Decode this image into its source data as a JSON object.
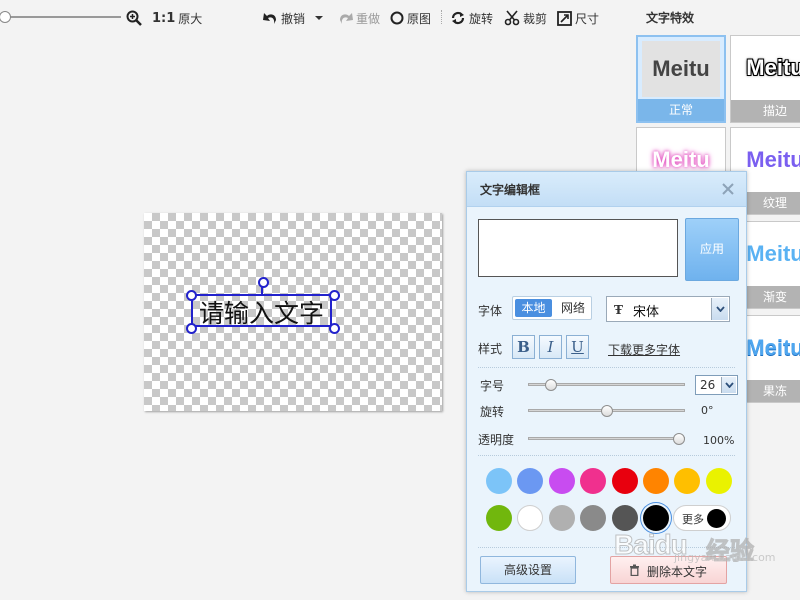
{
  "toolbar": {
    "actual_size_ratio": "1:1",
    "actual_size_label": "原大",
    "undo_label": "撤销",
    "redo_label": "重做",
    "original_label": "原图",
    "rotate_label": "旋转",
    "crop_label": "裁剪",
    "resize_label": "尺寸",
    "zoom_level": 0.0
  },
  "canvas": {
    "text": "请输入文字"
  },
  "effects": {
    "title": "文字特效",
    "items": [
      {
        "preview": "Meitu",
        "label": "正常",
        "selected": true
      },
      {
        "preview": "Meitu",
        "label": "描边",
        "selected": false
      },
      {
        "preview": "Meitu",
        "label": "",
        "selected": false
      },
      {
        "preview": "Meitu",
        "label": "纹理",
        "selected": false
      },
      {
        "preview": "Meitu",
        "label": "渐变",
        "selected": false
      },
      {
        "preview": "Meitu",
        "label": "果冻",
        "selected": false
      }
    ]
  },
  "dialog": {
    "title": "文字编辑框",
    "text_value": "",
    "apply_label": "应用",
    "font_label": "字体",
    "font_source_local": "本地",
    "font_source_web": "网络",
    "font_name": "宋体",
    "style_label": "样式",
    "bold_label": "B",
    "italic_label": "I",
    "underline_label": "U",
    "download_fonts_link": "下载更多字体",
    "size_label": "字号",
    "size_value": "26",
    "rotation_label": "旋转",
    "rotation_value": "0°",
    "opacity_label": "透明度",
    "opacity_value": "100%",
    "more_colors_label": "更多",
    "advanced_label": "高级设置",
    "delete_label": "删除本文字",
    "colors_row1": [
      "#7cc4f8",
      "#6b98f2",
      "#c84cf0",
      "#f0308e",
      "#e8000e",
      "#ff8400",
      "#ffbf00",
      "#eaf200"
    ],
    "colors_row2": [
      "#71b70d",
      "#ffffff",
      "#b0b0b0",
      "#8a8a8a",
      "#555555",
      "#000000"
    ],
    "selected_color": "#000000",
    "size_slider_fraction": 0.12,
    "rotation_slider_fraction": 0.5,
    "opacity_slider_fraction": 1.0
  },
  "watermark": {
    "brand": "Baidu",
    "brand_cn": "经验",
    "url": "jingyan.baidu.com"
  },
  "colors": {
    "accent": "#4a8fe0",
    "selection": "#2222cc"
  }
}
